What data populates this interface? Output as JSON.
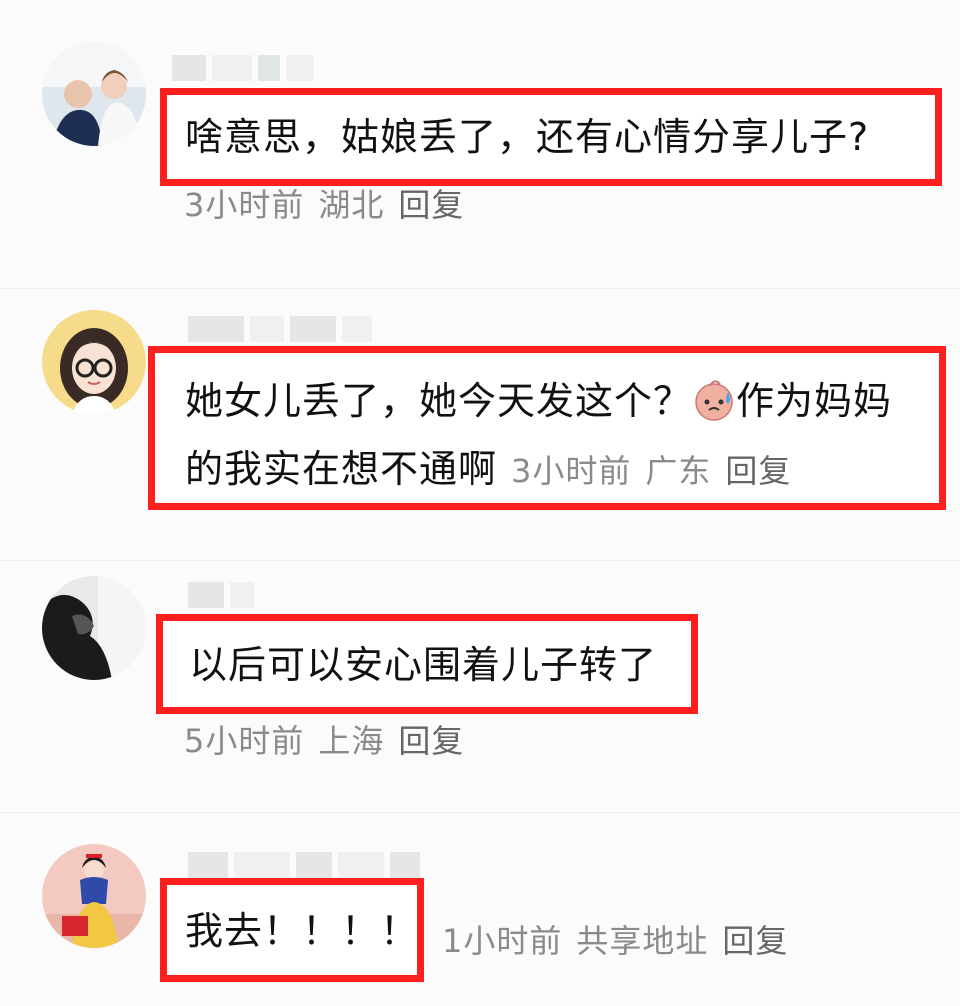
{
  "comments": [
    {
      "text": "啥意思，姑娘丢了，还有心情分享儿子?",
      "time": "3小时前",
      "location": "湖北",
      "reply": "回复"
    },
    {
      "text_line1": "她女儿丢了，她今天发这个？",
      "text_line1_after_emoji": "作为妈妈",
      "text_line2": "的我实在想不通啊",
      "emoji": "sweat-face-emoji",
      "time": "3小时前",
      "location": "广东",
      "reply": "回复"
    },
    {
      "text": "以后可以安心围着儿子转了",
      "time": "5小时前",
      "location": "上海",
      "reply": "回复"
    },
    {
      "text": "我去！！！！",
      "time": "1小时前",
      "location": "共享地址",
      "reply": "回复"
    }
  ],
  "colors": {
    "highlight_border": "#ff1f1f",
    "meta_text": "#8a8a8a",
    "body_text": "#111111",
    "background": "#fbfbfb"
  }
}
